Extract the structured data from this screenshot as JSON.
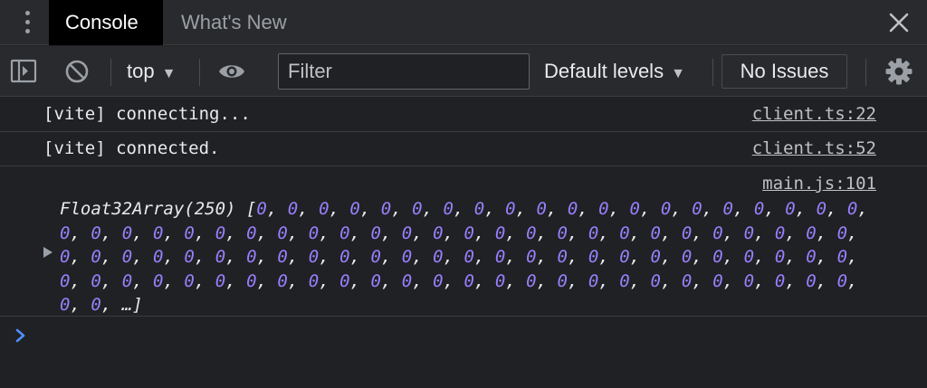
{
  "tabs": [
    {
      "label": "Console",
      "active": true
    },
    {
      "label": "What's New",
      "active": false
    }
  ],
  "icons": {
    "menu": "kebab-menu-icon",
    "close": "close-icon",
    "sidebar": "sidebar-toggle-icon",
    "clear": "clear-console-icon",
    "eye": "live-expression-eye-icon",
    "gear": "settings-gear-icon",
    "prompt": "chevron-right-icon",
    "expand": "expand-triangle-icon"
  },
  "toolbar": {
    "context": "top",
    "context_arrow": "▼",
    "filter_placeholder": "Filter",
    "levels": "Default levels",
    "levels_arrow": "▼",
    "issues": "No Issues"
  },
  "messages": [
    {
      "text": "[vite] connecting...",
      "source": "client.ts:22"
    },
    {
      "text": "[vite] connected.",
      "source": "client.ts:52"
    }
  ],
  "array_message": {
    "source": "main.js:101",
    "type_label": "Float32Array(250)",
    "open_bracket": "[",
    "value": "0",
    "shown_count": 100,
    "separator": ", ",
    "ellipsis": "…",
    "close_bracket": "]"
  },
  "colors": {
    "background": "#202124",
    "toolbar": "#292a2d",
    "active_tab": "#000000",
    "number": "#9980ff",
    "prompt": "#4d90fe"
  }
}
